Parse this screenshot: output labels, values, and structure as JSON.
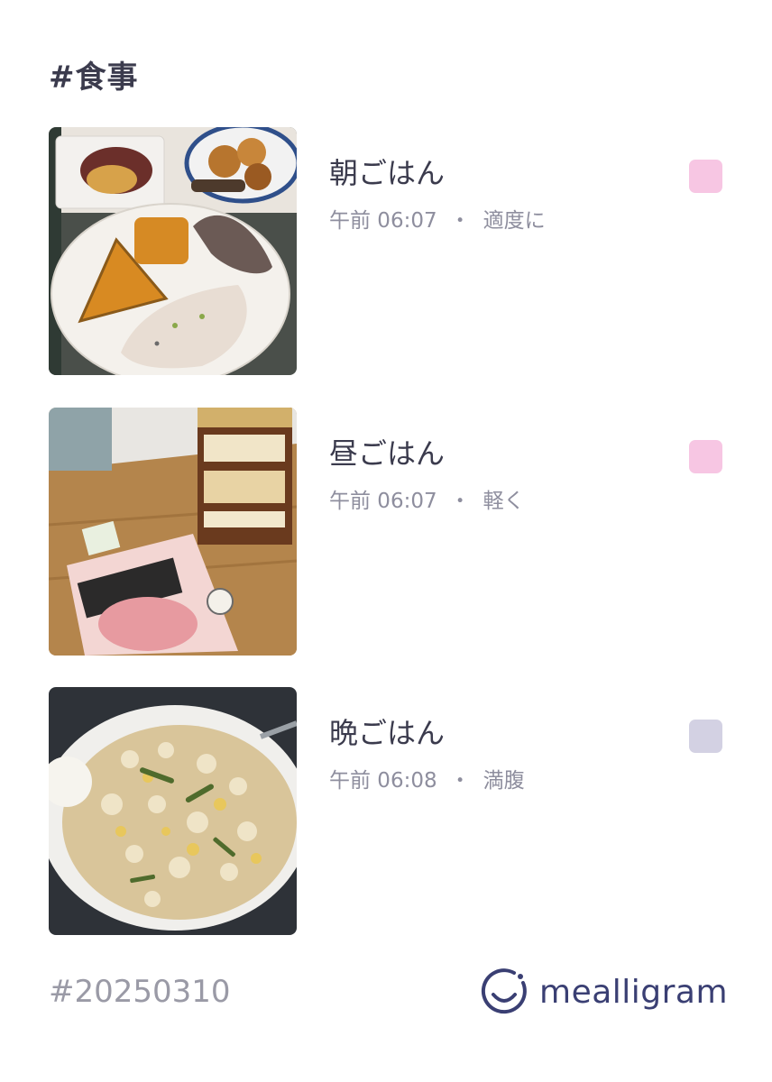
{
  "header": {
    "title": "#食事"
  },
  "meals": [
    {
      "title": "朝ごはん",
      "time": "午前 06:07",
      "separator": "・",
      "note": "適度に",
      "mood_color": "#f7c6e3",
      "photo": "breakfast-plate-photo"
    },
    {
      "title": "昼ごはん",
      "time": "午前 06:07",
      "separator": "・",
      "note": "軽く",
      "mood_color": "#f7c6e3",
      "photo": "protein-drink-and-jelly-photo"
    },
    {
      "title": "晩ごはん",
      "time": "午前 06:08",
      "separator": "・",
      "note": "満腹",
      "mood_color": "#d3d1e3",
      "photo": "fried-rice-photo"
    }
  ],
  "footer": {
    "tag": "#20250310",
    "brand": "mealligram",
    "brand_color": "#3a3f73"
  }
}
